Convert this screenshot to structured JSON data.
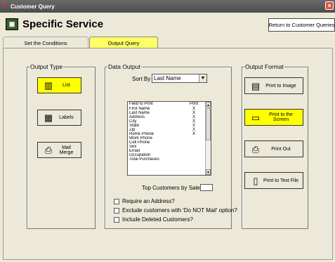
{
  "window": {
    "title": "Customer Query",
    "close_glyph": "×"
  },
  "header": {
    "title": "Specific Service",
    "return_label": "Return to Customer Queries"
  },
  "tabs": [
    {
      "label": "Set the Conditions",
      "active": false
    },
    {
      "label": "Output Query",
      "active": true
    }
  ],
  "output_type": {
    "legend": "Output Type",
    "buttons": [
      {
        "label": "List",
        "icon": "list-icon",
        "selected": true
      },
      {
        "label": "Labels",
        "icon": "labels-icon",
        "selected": false
      },
      {
        "label": "Mail Merge",
        "icon": "mail-merge-icon",
        "selected": false
      }
    ]
  },
  "data_output": {
    "legend": "Data Output",
    "sort_by_label": "Sort By",
    "sort_by_value": "Last Name",
    "columns": [
      "Field to Print",
      "Print"
    ],
    "fields": [
      {
        "name": "First Name",
        "mark": "X"
      },
      {
        "name": "Last Name",
        "mark": "X"
      },
      {
        "name": "Address",
        "mark": "X"
      },
      {
        "name": "City",
        "mark": "X"
      },
      {
        "name": "State",
        "mark": "X"
      },
      {
        "name": "Zip",
        "mark": "X"
      },
      {
        "name": "Home Phone",
        "mark": "X"
      },
      {
        "name": "Work Phone",
        "mark": ""
      },
      {
        "name": "Cell Phone",
        "mark": ""
      },
      {
        "name": "Sex",
        "mark": ""
      },
      {
        "name": "Email",
        "mark": ""
      },
      {
        "name": "Occupation",
        "mark": ""
      },
      {
        "name": "Total Purchases",
        "mark": ""
      }
    ],
    "top_customers_label": "Top Customers by Sales",
    "top_customers_value": "",
    "options": [
      {
        "label": "Require an Address?",
        "checked": false
      },
      {
        "label": "Exclude customers with 'Do NOT Mail' option?",
        "checked": false
      },
      {
        "label": "Include Deleted Customers?",
        "checked": false
      }
    ]
  },
  "output_format": {
    "legend": "Output Format",
    "buttons": [
      {
        "label": "Print to Image",
        "icon": "image-icon",
        "selected": false
      },
      {
        "label": "Print to the Screen",
        "icon": "monitor-icon",
        "selected": true
      },
      {
        "label": "Print Out",
        "icon": "printer-icon",
        "selected": false
      },
      {
        "label": "Print to Text File",
        "icon": "text-file-icon",
        "selected": false
      }
    ]
  },
  "colors": {
    "selected": "#ffff00",
    "active_tab": "#ffff66",
    "background": "#ece9d8"
  }
}
